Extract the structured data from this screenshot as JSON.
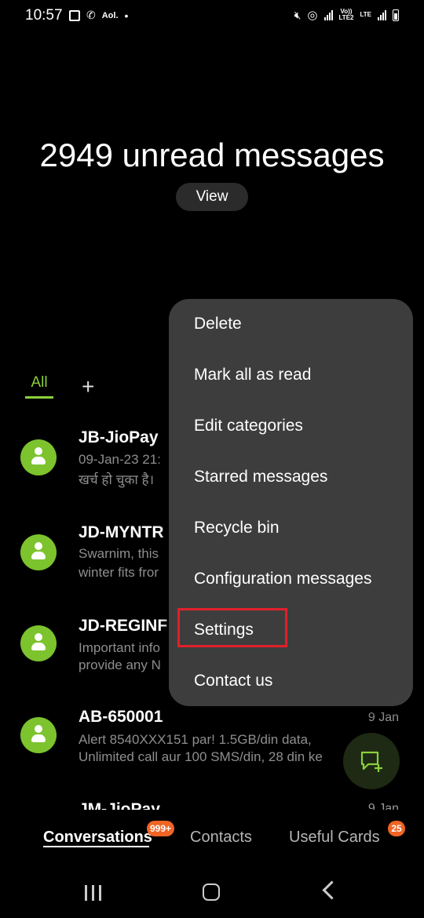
{
  "status_bar": {
    "time": "10:57",
    "carrier_text": "Aol.",
    "volte_text": "Vo))\nLTE2",
    "lte_text": "LTE",
    "icons": [
      "gallery-icon",
      "missed-call-icon",
      "dot-icon",
      "mute-icon",
      "hotspot-icon",
      "signal-icon",
      "battery-icon"
    ]
  },
  "header": {
    "unread_title": "2949 unread messages",
    "view_label": "View"
  },
  "category_tabs": {
    "all_label": "All",
    "add_label": "+"
  },
  "conversations": [
    {
      "name": "JB-JioPay",
      "line1": "09-Jan-23 21:",
      "line2": "खर्च हो चुका है। ",
      "date": ""
    },
    {
      "name": "JD-MYNTR",
      "line1": "Swarnim, this",
      "line2": "winter fits fror",
      "date": ""
    },
    {
      "name": "JD-REGINF",
      "line1": "Important info",
      "line2": "provide any N",
      "date": ""
    },
    {
      "name": "AB-650001",
      "line1": "Alert 8540XXX151 par! 1.5GB/din data,",
      "line2": "Unlimited call aur 100 SMS/din, 28 din ke",
      "date": "9 Jan"
    },
    {
      "name": "JM-JioPay",
      "line1": "",
      "line2": "",
      "date": "9 Jan"
    }
  ],
  "menu": {
    "items": [
      "Delete",
      "Mark all as read",
      "Edit categories",
      "Starred messages",
      "Recycle bin",
      "Configuration messages",
      "Settings",
      "Contact us"
    ],
    "highlighted": "Settings",
    "highlight_color": "#e0202a"
  },
  "bottom_tabs": {
    "conversations_label": "Conversations",
    "conversations_badge": "999+",
    "contacts_label": "Contacts",
    "useful_cards_label": "Useful Cards",
    "useful_cards_badge": "25",
    "badge_color": "#f06424"
  },
  "colors": {
    "accent": "#8bd03a",
    "avatar": "#7cc32e",
    "menu_bg": "#3d3d3d",
    "background": "#000000"
  }
}
